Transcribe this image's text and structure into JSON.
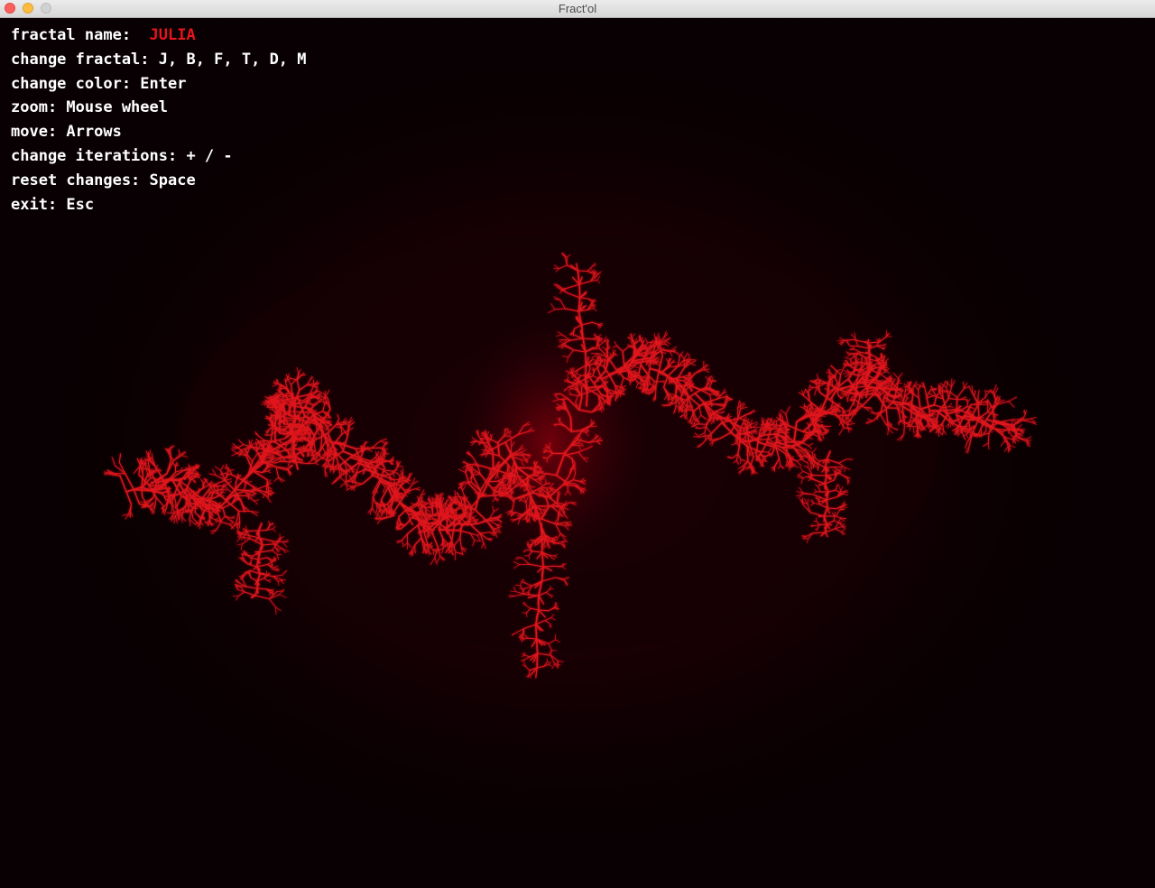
{
  "window": {
    "title": "Fract'ol"
  },
  "hud": {
    "fractal_name_label": "fractal name:",
    "fractal_name_value": "JULIA",
    "lines": [
      "change fractal: J, B, F, T, D, M",
      "change color: Enter",
      "zoom: Mouse wheel",
      "move: Arrows",
      "change iterations: + / -",
      "reset changes: Space",
      "exit: Esc"
    ]
  },
  "colors": {
    "background": "#080002",
    "fractal": "#e0141c",
    "fractal_core": "#2a0005",
    "fractal_name_highlight": "#e8141c",
    "hud_text": "#ffffff"
  },
  "icons": {
    "close": "close-traffic-light-icon",
    "minimize": "minimize-traffic-light-icon",
    "zoom": "zoom-traffic-light-icon"
  }
}
